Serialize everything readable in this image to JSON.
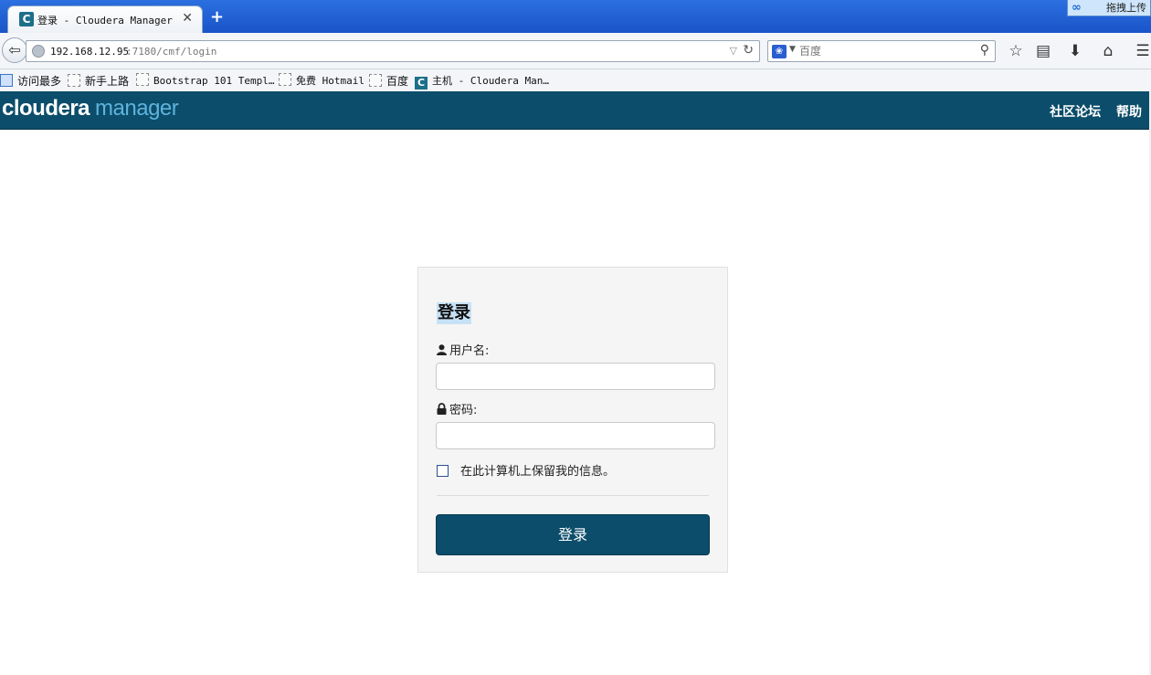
{
  "browser": {
    "tab_title": "登录 - Cloudera Manager",
    "tab_close": "✕",
    "new_tab": "+",
    "favicon_letter": "C",
    "upload_widget_label": "拖拽上传",
    "url_host": "192.168.12.95",
    "url_rest": ":7180/cmf/login",
    "search_placeholder": "百度",
    "bookmarks": [
      {
        "label": "访问最多"
      },
      {
        "label": "新手上路"
      },
      {
        "label": "Bootstrap 101 Templ…"
      },
      {
        "label": "免费 Hotmail"
      },
      {
        "label": "百度"
      },
      {
        "label": "主机 - Cloudera Man…"
      }
    ]
  },
  "header": {
    "logo_part1": "cloudera",
    "logo_part2": "manager",
    "links": [
      "社区论坛",
      "帮助"
    ],
    "color": "#0b4d6a"
  },
  "login": {
    "title": "登录",
    "username_label": "用户名:",
    "password_label": "密码:",
    "username_value": "",
    "password_value": "",
    "remember_label": "在此计算机上保留我的信息。",
    "remember_checked": false,
    "submit_label": "登录"
  }
}
